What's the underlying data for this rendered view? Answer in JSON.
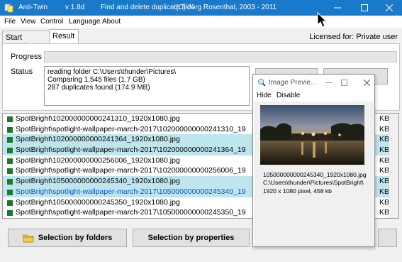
{
  "window": {
    "app_name": "Anti-Twin",
    "version": "v 1.8d",
    "subtitle": "Find and delete duplicate files",
    "copyright": "(C) Jörg Rosenthal, 2003 - 2011"
  },
  "menu": [
    "File",
    "View",
    "Control",
    "Language",
    "About"
  ],
  "tabs": {
    "start": "Start search",
    "result": "Result"
  },
  "license": "Licensed for: Private user",
  "labels": {
    "progress": "Progress",
    "status": "Status"
  },
  "status_lines": [
    "reading folder C:\\Users\\thunder\\Pictures\\",
    "Comparing 1,545 files (1.7 GB)",
    "287 duplicates found (174.9 MB)"
  ],
  "files": [
    {
      "name": "SpotBright\\102000000000241310_1920x1080.jpg",
      "size": "KB",
      "selected": false,
      "focused": false
    },
    {
      "name": "SpotBright\\spotlight-wallpaper-march-2017\\102000000000241310_19",
      "size": "KB",
      "selected": false,
      "focused": false
    },
    {
      "name": "SpotBright\\102000000000241364_1920x1080.jpg",
      "size": "KB",
      "selected": true,
      "focused": false
    },
    {
      "name": "SpotBright\\spotlight-wallpaper-march-2017\\102000000000241364_19",
      "size": "KB",
      "selected": true,
      "focused": false
    },
    {
      "name": "SpotBright\\102000000000256006_1920x1080.jpg",
      "size": "KB",
      "selected": false,
      "focused": false
    },
    {
      "name": "SpotBright\\spotlight-wallpaper-march-2017\\102000000000256006_19",
      "size": "KB",
      "selected": false,
      "focused": false
    },
    {
      "name": "SpotBright\\105000000000245340_1920x1080.jpg",
      "size": "KB",
      "selected": true,
      "focused": false
    },
    {
      "name": "SpotBright\\spotlight-wallpaper-march-2017\\105000000000245340_19",
      "size": "KB",
      "selected": true,
      "focused": true
    },
    {
      "name": "SpotBright\\105000000000245350_1920x1080.jpg",
      "size": "KB",
      "selected": false,
      "focused": false
    },
    {
      "name": "SpotBright\\spotlight-wallpaper-march-2017\\105000000000245350_19",
      "size": "KB",
      "selected": false,
      "focused": false
    }
  ],
  "buttons": {
    "by_folders": "Selection by folders",
    "by_properties": "Selection by properties"
  },
  "preview": {
    "title": "Image Previe...",
    "menu": {
      "hide": "Hide",
      "disable": "Disable"
    },
    "filename": "105000000000245340_1920x1080.jpg",
    "path": "C:\\Users\\thunder\\Pictures\\SpotBright\\",
    "dims": "1920 x 1080 pixel, 458 kb"
  },
  "colors": {
    "titlebar": "#1979ca",
    "row_selected": "#bfe6ef",
    "row_marker": "#1b7a2c",
    "focused_text": "#0a4fd0"
  },
  "icons": [
    "app-icon",
    "minimize-icon",
    "maximize-icon",
    "close-icon",
    "folder-icon",
    "magnifier-icon",
    "mouse-cursor-icon"
  ]
}
